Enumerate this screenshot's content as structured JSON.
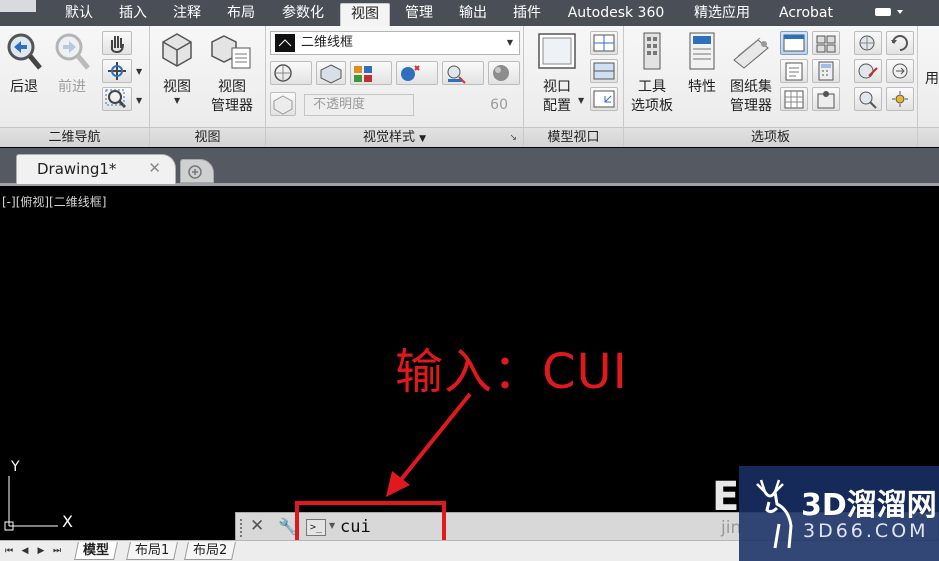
{
  "ribbon_tabs": [
    {
      "label": "默认"
    },
    {
      "label": "插入"
    },
    {
      "label": "注释"
    },
    {
      "label": "布局"
    },
    {
      "label": "参数化"
    },
    {
      "label": "视图",
      "active": true
    },
    {
      "label": "管理"
    },
    {
      "label": "输出"
    },
    {
      "label": "插件"
    },
    {
      "label": "Autodesk 360"
    },
    {
      "label": "精选应用"
    },
    {
      "label": "Acrobat"
    }
  ],
  "panels": {
    "nav2d": {
      "title": "二维导航",
      "back": "后退",
      "forward": "前进"
    },
    "view": {
      "title": "视图",
      "view_btn": "视图",
      "view_mgr_line1": "视图",
      "view_mgr_line2": "管理器"
    },
    "visual_styles": {
      "title": "视觉样式",
      "style_value": "二维线框",
      "opacity_label": "不透明度",
      "opacity_value": "60"
    },
    "model_viewports": {
      "title": "模型视口",
      "config_line1": "视口",
      "config_line2": "配置"
    },
    "palettes": {
      "title": "选项板",
      "tool_line1": "工具",
      "tool_line2": "选项板",
      "properties": "特性",
      "sheetset_line1": "图纸集",
      "sheetset_line2": "管理器",
      "overflow": "用"
    }
  },
  "document": {
    "tab": "Drawing1*"
  },
  "viewport": {
    "label": "[-][俯视][二维线框]"
  },
  "annotation": {
    "text": "输入：CUI"
  },
  "ucs": {
    "y": "Y",
    "x": "X"
  },
  "command": {
    "value": "cui",
    "prompt_glyph": ">_"
  },
  "layout_tabs": [
    {
      "label": "模型",
      "active": true
    },
    {
      "label": "布局1"
    },
    {
      "label": "布局2"
    }
  ],
  "watermark": {
    "brand": "3D溜溜网",
    "domain": "3D66.COM",
    "ghost_big": "E",
    "ghost_small": "jin"
  },
  "colors": {
    "annotation": "#e0191f",
    "ribbon_bar": "#4a4f57",
    "canvas": "#000000"
  }
}
